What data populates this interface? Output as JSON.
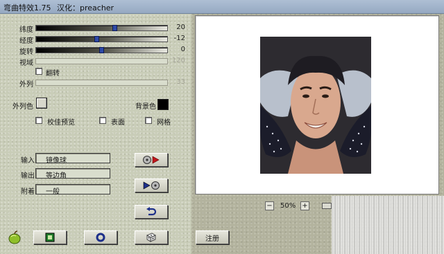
{
  "window": {
    "title": "弯曲特效1.75",
    "credit": "汉化：preacher"
  },
  "sliders": [
    {
      "label": "纬度",
      "value": "20",
      "position": 0.61
    },
    {
      "label": "经度",
      "value": "-12",
      "position": 0.46
    },
    {
      "label": "旋转",
      "value": "0",
      "position": 0.5
    },
    {
      "label": "视域",
      "value": "120",
      "position": null
    },
    {
      "label": "外列",
      "value": "33",
      "position": null
    }
  ],
  "flip": {
    "label": "翻转",
    "checked": false
  },
  "colors": {
    "outer_label": "外列色",
    "outer_value": "#d8d8cc",
    "background_label": "背景色",
    "background_value": "#000000"
  },
  "options": [
    {
      "label": "校佳预览",
      "checked": false
    },
    {
      "label": "表面",
      "checked": false
    },
    {
      "label": "网格",
      "checked": false
    }
  ],
  "fields": [
    {
      "label": "输入",
      "value": "镜像球"
    },
    {
      "label": "输出",
      "value": "等边角"
    },
    {
      "label": "附着",
      "value": "一般"
    }
  ],
  "buttons": {
    "register": "注册"
  },
  "zoom": {
    "level": "50%",
    "minus": "−",
    "plus": "+"
  }
}
